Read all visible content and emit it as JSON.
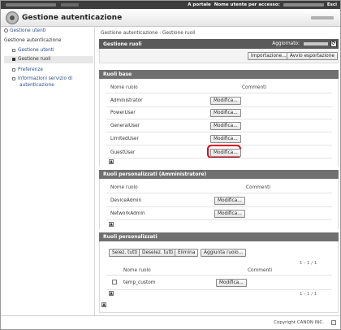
{
  "topbar": {
    "portal_link": "A portale",
    "user_label": "Nome utente per accesso:",
    "suffix": "Esci"
  },
  "header": {
    "title": "Gestione autenticazione"
  },
  "nav": {
    "home": "Gestione utenti",
    "section_title": "Gestione autenticazione",
    "items": [
      {
        "label": "Gestione utenti"
      },
      {
        "label": "Gestione ruoli"
      },
      {
        "label": "Preferenze"
      },
      {
        "label": "Informazioni servizio di"
      },
      {
        "label": "autenticazione"
      }
    ]
  },
  "main": {
    "breadcrumb": "Gestione autenticazione : Gestione ruoli",
    "title": "Gestione ruoli",
    "updated_label": "Aggiornato:",
    "import_button": "Importazione...",
    "export_button": "Avvio esportazione",
    "base_roles": {
      "header": "Ruoli base",
      "col_name": "Nome ruolo",
      "col_comments": "Commenti",
      "edit_label": "Modifica...",
      "rows": [
        {
          "name": "Administrator"
        },
        {
          "name": "PowerUser"
        },
        {
          "name": "GeneralUser"
        },
        {
          "name": "LimitedUser"
        },
        {
          "name": "GuestUser"
        }
      ]
    },
    "custom_admin_roles": {
      "header": "Ruoli personalizzati (Amministratore)",
      "col_name": "Nome ruolo",
      "col_comments": "Commenti",
      "edit_label": "Modifica...",
      "rows": [
        {
          "name": "DeviceAdmin"
        },
        {
          "name": "NetworkAdmin"
        }
      ]
    },
    "custom_roles": {
      "header": "Ruoli personalizzati",
      "select_all": "Selez. tutti",
      "deselect_all": "Deselez. tutti",
      "delete": "Elimina",
      "add": "Aggiunta ruolo...",
      "pager_top": "1 - 1 / 1",
      "col_name": "Nome ruolo",
      "col_comments": "Commenti",
      "edit_label": "Modifica...",
      "rows": [
        {
          "name": "temp_custom"
        }
      ],
      "pager_bottom": "1 - 1 / 1"
    }
  },
  "footer": {
    "copyright": "Copyright CANON INC."
  },
  "colors": {
    "highlight": "#e0001a",
    "panel_header": "#707070",
    "topbar": "#3d3d3d"
  }
}
